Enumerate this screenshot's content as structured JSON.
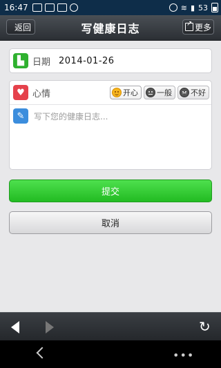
{
  "statusbar": {
    "time": "16:47",
    "battery": "53"
  },
  "header": {
    "back_label": "返回",
    "title": "写健康日志",
    "more_label": "更多"
  },
  "date": {
    "label": "日期",
    "value": "2014-01-26"
  },
  "mood": {
    "label": "心情",
    "options": [
      {
        "label": "开心",
        "icon": "happy-face-icon"
      },
      {
        "label": "一般",
        "icon": "neutral-face-icon"
      },
      {
        "label": "不好",
        "icon": "sad-face-icon"
      }
    ]
  },
  "note": {
    "placeholder": "写下您的健康日志..."
  },
  "actions": {
    "submit_label": "提交",
    "cancel_label": "取消"
  },
  "colors": {
    "accent_green": "#2fb12f",
    "title_bar": "#33373c",
    "status_bar": "#0e2d49"
  }
}
